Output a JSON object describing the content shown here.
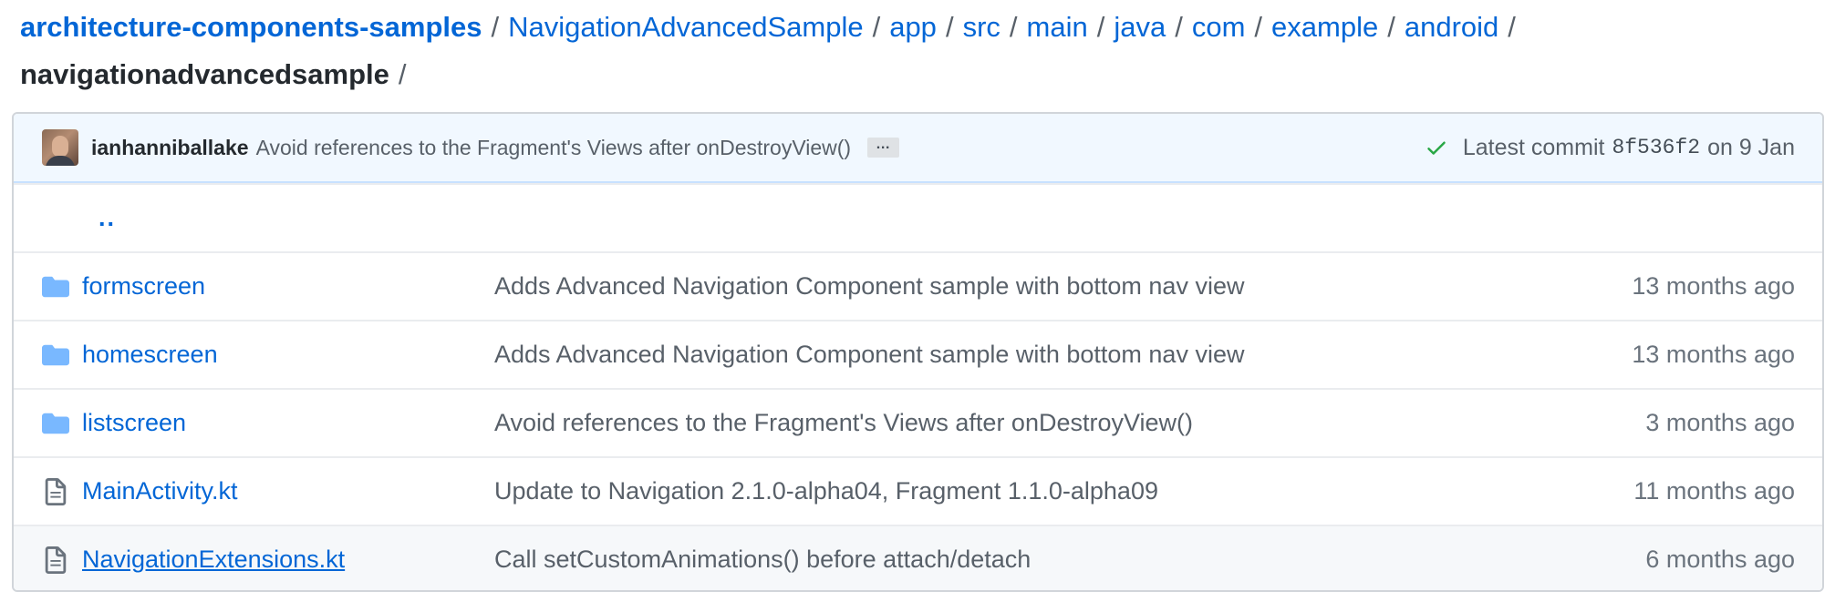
{
  "breadcrumb": {
    "repo": "architecture-components-samples",
    "path": [
      "NavigationAdvancedSample",
      "app",
      "src",
      "main",
      "java",
      "com",
      "example",
      "android"
    ],
    "separator": "/",
    "current": "navigationadvancedsample",
    "trailing": "/"
  },
  "commit": {
    "author": "ianhanniballake",
    "message": "Avoid references to the Fragment's Views after onDestroyView()",
    "ellipsis": "…",
    "latest_label": "Latest commit",
    "sha": "8f536f2",
    "date": "on 9 Jan",
    "status_color": "#28a745"
  },
  "parent_dir": "..",
  "files": [
    {
      "type": "folder",
      "icon": "folder-icon",
      "name": "formscreen",
      "message": "Adds Advanced Navigation Component sample with bottom nav view",
      "age": "13 months ago"
    },
    {
      "type": "folder",
      "icon": "folder-icon",
      "name": "homescreen",
      "message": "Adds Advanced Navigation Component sample with bottom nav view",
      "age": "13 months ago"
    },
    {
      "type": "folder",
      "icon": "folder-icon",
      "name": "listscreen",
      "message": "Avoid references to the Fragment's Views after onDestroyView()",
      "age": "3 months ago"
    },
    {
      "type": "file",
      "icon": "file-icon",
      "name": "MainActivity.kt",
      "message": "Update to Navigation 2.1.0-alpha04, Fragment 1.1.0-alpha09",
      "age": "11 months ago"
    },
    {
      "type": "file",
      "icon": "file-icon",
      "name": "NavigationExtensions.kt",
      "message": "Call setCustomAnimations() before attach/detach",
      "age": "6 months ago"
    }
  ],
  "colors": {
    "link": "#0366d6",
    "folder_icon": "#79b8ff",
    "file_icon": "#6a737d"
  }
}
